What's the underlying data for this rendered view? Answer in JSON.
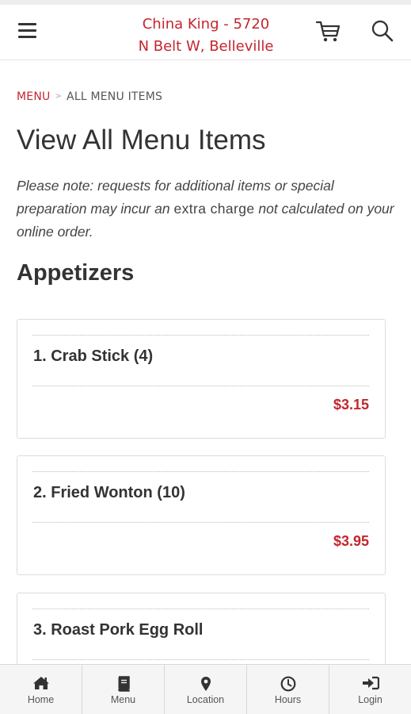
{
  "header": {
    "store_line1": "China King - 5720",
    "store_line2": "N Belt W, Belleville",
    "menu_icon": "hamburger-icon",
    "cart_icon": "cart-icon",
    "search_icon": "search-icon"
  },
  "breadcrumb": {
    "menu": "MENU",
    "current": "ALL MENU ITEMS"
  },
  "page": {
    "title": "View All Menu Items",
    "note_part1": "Please note: requests for additional items or special preparation may incur an ",
    "note_extra": "extra charge",
    "note_part2": " not calculated on your online order."
  },
  "section": {
    "title": "Appetizers"
  },
  "items": [
    {
      "name": "1. Crab Stick (4)",
      "price": "$3.15"
    },
    {
      "name": "2. Fried Wonton (10)",
      "price": "$3.95"
    },
    {
      "name": "3. Roast Pork Egg Roll",
      "price": ""
    }
  ],
  "bottom_nav": [
    {
      "label": "Home",
      "icon": "home-icon"
    },
    {
      "label": "Menu",
      "icon": "book-icon"
    },
    {
      "label": "Location",
      "icon": "map-pin-icon"
    },
    {
      "label": "Hours",
      "icon": "clock-icon"
    },
    {
      "label": "Login",
      "icon": "sign-in-icon"
    }
  ],
  "colors": {
    "accent": "#c4262e",
    "text": "#333333",
    "nav_bg": "#f5f5f5"
  }
}
